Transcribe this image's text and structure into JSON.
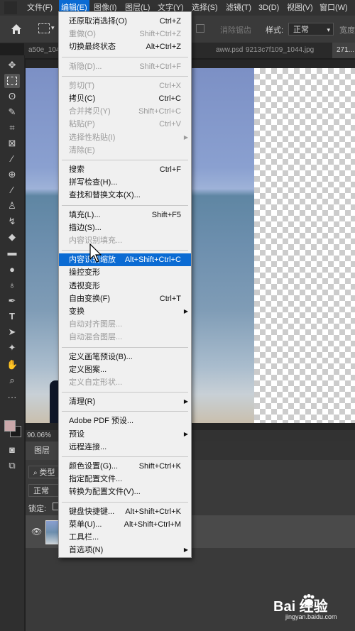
{
  "menubar": {
    "items": [
      {
        "label": "文件(F)",
        "active": false
      },
      {
        "label": "编辑(E)",
        "active": true
      },
      {
        "label": "图像(I)",
        "active": false
      },
      {
        "label": "图层(L)",
        "active": false
      },
      {
        "label": "文字(Y)",
        "active": false
      },
      {
        "label": "选择(S)",
        "active": false
      },
      {
        "label": "滤镜(T)",
        "active": false
      },
      {
        "label": "3D(D)",
        "active": false
      },
      {
        "label": "视图(V)",
        "active": false
      },
      {
        "label": "窗口(W)",
        "active": false
      }
    ]
  },
  "options_bar": {
    "antialias_label": "消除锯齿",
    "style_label": "样式:",
    "style_value": "正常",
    "width_label": "宽度"
  },
  "doc_tabs": [
    {
      "label": "a50e_104...",
      "current": false
    },
    {
      "label": "aww.psd",
      "current": false
    },
    {
      "label": "9213c7f109_1044.jpg",
      "current": false
    },
    {
      "label": "271...",
      "current": true
    }
  ],
  "status": {
    "zoom": "90.06%"
  },
  "layers_panel": {
    "tab_label": "图层",
    "filter_label": "类型",
    "blend_mode": "正常",
    "lock_label": "锁定:"
  },
  "edit_menu": {
    "groups": [
      [
        {
          "label": "还原取消选择(O)",
          "shortcut": "Ctrl+Z",
          "enabled": true
        },
        {
          "label": "重做(O)",
          "shortcut": "Shift+Ctrl+Z",
          "enabled": false
        },
        {
          "label": "切换最终状态",
          "shortcut": "Alt+Ctrl+Z",
          "enabled": true
        }
      ],
      [
        {
          "label": "渐隐(D)...",
          "shortcut": "Shift+Ctrl+F",
          "enabled": false
        }
      ],
      [
        {
          "label": "剪切(T)",
          "shortcut": "Ctrl+X",
          "enabled": false
        },
        {
          "label": "拷贝(C)",
          "shortcut": "Ctrl+C",
          "enabled": true
        },
        {
          "label": "合并拷贝(Y)",
          "shortcut": "Shift+Ctrl+C",
          "enabled": false
        },
        {
          "label": "粘贴(P)",
          "shortcut": "Ctrl+V",
          "enabled": false
        },
        {
          "label": "选择性粘贴(I)",
          "shortcut": "",
          "enabled": false,
          "submenu": true
        },
        {
          "label": "清除(E)",
          "shortcut": "",
          "enabled": false
        }
      ],
      [
        {
          "label": "搜索",
          "shortcut": "Ctrl+F",
          "enabled": true
        },
        {
          "label": "拼写检查(H)...",
          "shortcut": "",
          "enabled": true
        },
        {
          "label": "查找和替换文本(X)...",
          "shortcut": "",
          "enabled": true
        }
      ],
      [
        {
          "label": "填充(L)...",
          "shortcut": "Shift+F5",
          "enabled": true
        },
        {
          "label": "描边(S)...",
          "shortcut": "",
          "enabled": true
        },
        {
          "label": "内容识别填充...",
          "shortcut": "",
          "enabled": false
        }
      ],
      [
        {
          "label": "内容识别缩放",
          "shortcut": "Alt+Shift+Ctrl+C",
          "enabled": true,
          "highlighted": true
        },
        {
          "label": "操控变形",
          "shortcut": "",
          "enabled": true
        },
        {
          "label": "透视变形",
          "shortcut": "",
          "enabled": true
        },
        {
          "label": "自由变换(F)",
          "shortcut": "Ctrl+T",
          "enabled": true
        },
        {
          "label": "变换",
          "shortcut": "",
          "enabled": true,
          "submenu": true
        },
        {
          "label": "自动对齐图层...",
          "shortcut": "",
          "enabled": false
        },
        {
          "label": "自动混合图层...",
          "shortcut": "",
          "enabled": false
        }
      ],
      [
        {
          "label": "定义画笔预设(B)...",
          "shortcut": "",
          "enabled": true
        },
        {
          "label": "定义图案...",
          "shortcut": "",
          "enabled": true
        },
        {
          "label": "定义自定形状...",
          "shortcut": "",
          "enabled": false
        }
      ],
      [
        {
          "label": "清理(R)",
          "shortcut": "",
          "enabled": true,
          "submenu": true
        }
      ],
      [
        {
          "label": "Adobe PDF 预设...",
          "shortcut": "",
          "enabled": true
        },
        {
          "label": "预设",
          "shortcut": "",
          "enabled": true,
          "submenu": true
        },
        {
          "label": "远程连接...",
          "shortcut": "",
          "enabled": true
        }
      ],
      [
        {
          "label": "颜色设置(G)...",
          "shortcut": "Shift+Ctrl+K",
          "enabled": true
        },
        {
          "label": "指定配置文件...",
          "shortcut": "",
          "enabled": true
        },
        {
          "label": "转换为配置文件(V)...",
          "shortcut": "",
          "enabled": true
        }
      ],
      [
        {
          "label": "键盘快捷键...",
          "shortcut": "Alt+Shift+Ctrl+K",
          "enabled": true
        },
        {
          "label": "菜单(U)...",
          "shortcut": "Alt+Shift+Ctrl+M",
          "enabled": true
        },
        {
          "label": "工具栏...",
          "shortcut": "",
          "enabled": true
        },
        {
          "label": "首选项(N)",
          "shortcut": "",
          "enabled": true,
          "submenu": true
        }
      ]
    ]
  },
  "watermark": {
    "brand": "Bai 经验",
    "url": "jingyan.baidu.com"
  },
  "colors": {
    "accent": "#0b6bd3",
    "menu_bg": "#f0f0f0",
    "app_bg": "#323232"
  }
}
